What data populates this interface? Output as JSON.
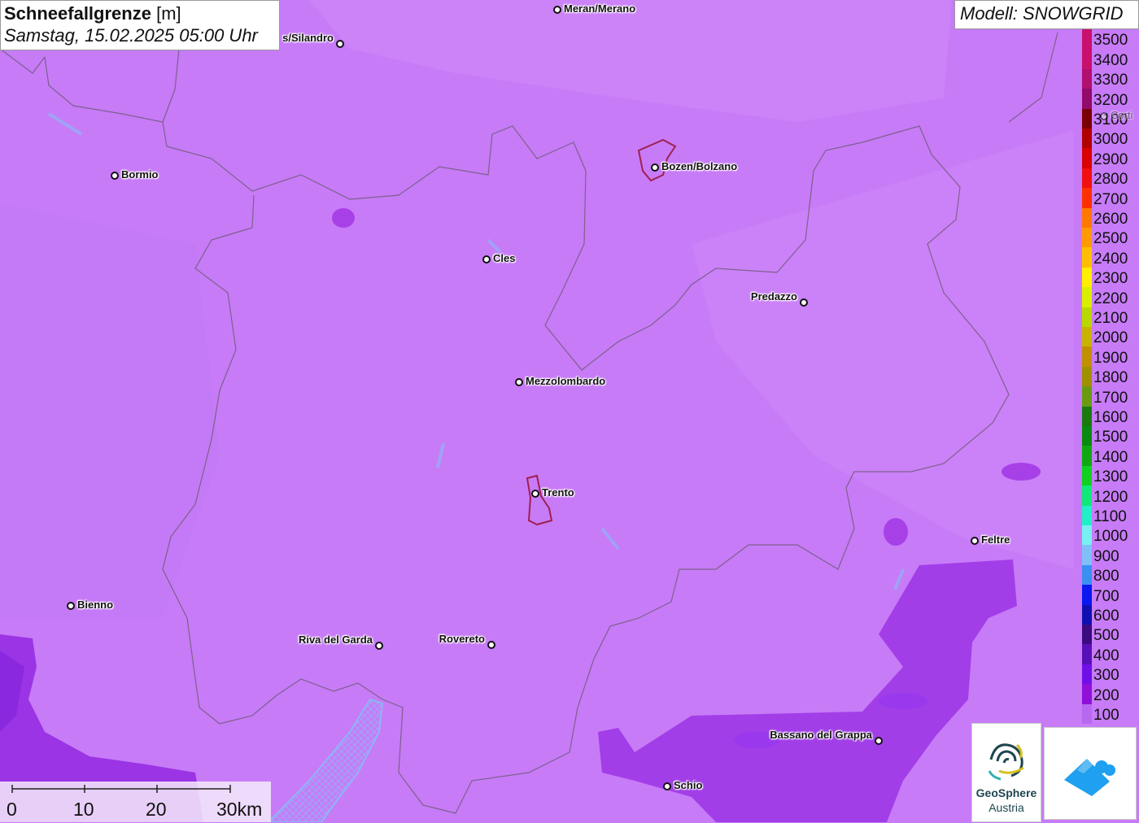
{
  "header": {
    "title_bold": "Schneefallgrenze",
    "title_unit": "[m]",
    "subtitle": "Samstag, 15.02.2025 05:00 Uhr"
  },
  "model": {
    "label": "Modell: SNOWGRID"
  },
  "legend": {
    "items": [
      {
        "value": "3500",
        "color": "#c8106e"
      },
      {
        "value": "3400",
        "color": "#c8106e"
      },
      {
        "value": "3300",
        "color": "#b00f70"
      },
      {
        "value": "3200",
        "color": "#920a6a"
      },
      {
        "value": "3100",
        "color": "#7a0000"
      },
      {
        "value": "3000",
        "color": "#b00000"
      },
      {
        "value": "2900",
        "color": "#d80000"
      },
      {
        "value": "2800",
        "color": "#f01010"
      },
      {
        "value": "2700",
        "color": "#ff3000"
      },
      {
        "value": "2600",
        "color": "#ff7800"
      },
      {
        "value": "2500",
        "color": "#ff9a00"
      },
      {
        "value": "2400",
        "color": "#ffbe00"
      },
      {
        "value": "2300",
        "color": "#ffef00"
      },
      {
        "value": "2200",
        "color": "#d8f000"
      },
      {
        "value": "2100",
        "color": "#b8d800"
      },
      {
        "value": "2000",
        "color": "#c8b400"
      },
      {
        "value": "1900",
        "color": "#c09000"
      },
      {
        "value": "1800",
        "color": "#a09000"
      },
      {
        "value": "1700",
        "color": "#6a9a10"
      },
      {
        "value": "1600",
        "color": "#1a7a10"
      },
      {
        "value": "1500",
        "color": "#0a8a10"
      },
      {
        "value": "1400",
        "color": "#10a810"
      },
      {
        "value": "1300",
        "color": "#10d020"
      },
      {
        "value": "1200",
        "color": "#10e878"
      },
      {
        "value": "1100",
        "color": "#20f0c8"
      },
      {
        "value": "1000",
        "color": "#78f0f0"
      },
      {
        "value": "900",
        "color": "#80c0f8"
      },
      {
        "value": "800",
        "color": "#3890f0"
      },
      {
        "value": "700",
        "color": "#0a18f0"
      },
      {
        "value": "600",
        "color": "#1010b0"
      },
      {
        "value": "500",
        "color": "#3a0a80"
      },
      {
        "value": "400",
        "color": "#5a10b8"
      },
      {
        "value": "300",
        "color": "#7010e8"
      },
      {
        "value": "200",
        "color": "#9010d8"
      },
      {
        "value": "100",
        "color": "#b868f0"
      }
    ]
  },
  "cities": [
    {
      "name": "Meran/Merano"
    },
    {
      "name": "Schlanders/Silandro",
      "visible": "s/Silandro"
    },
    {
      "name": "Bozen/Bolzano"
    },
    {
      "name": "Bormio"
    },
    {
      "name": "Cles"
    },
    {
      "name": "Predazzo"
    },
    {
      "name": "Mezzolombardo"
    },
    {
      "name": "Trento"
    },
    {
      "name": "Feltre"
    },
    {
      "name": "Bienno"
    },
    {
      "name": "Riva del Garda"
    },
    {
      "name": "Rovereto"
    },
    {
      "name": "Bassano del Grappa"
    },
    {
      "name": "Schio"
    },
    {
      "name": "Cortina",
      "visible": "Corti"
    }
  ],
  "scale_bar": {
    "labels": [
      "0",
      "10",
      "20",
      "30km"
    ]
  },
  "logos": {
    "geosphere_name": "GeoSphere",
    "geosphere_sub": "Austria"
  },
  "colors": {
    "base": "#c77bf7",
    "dark_zone": "#a640e8",
    "light_zone": "#d38af8",
    "water": "#8fb4f5",
    "border": "#6a5a70",
    "city_outline": "#a02050"
  }
}
